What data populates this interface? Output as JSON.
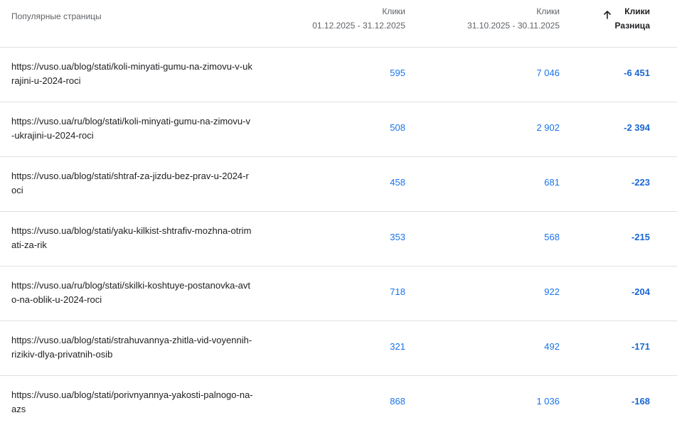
{
  "header": {
    "page_col": "Популярные страницы",
    "col1_metric": "Клики",
    "col1_period": "01.12.2025 - 31.12.2025",
    "col2_metric": "Клики",
    "col2_period": "31.10.2025 - 30.11.2025",
    "col3_metric": "Клики",
    "col3_sub": "Разница",
    "sort_icon": "arrow-up-icon"
  },
  "rows": [
    {
      "url": "https://vuso.ua/blog/stati/koli-minyati-gumu-na-zimovu-v-ukrajini-u-2024-roci",
      "clicks_current": "595",
      "clicks_previous": "7 046",
      "diff": "-6 451"
    },
    {
      "url": "https://vuso.ua/ru/blog/stati/koli-minyati-gumu-na-zimovu-v-ukrajini-u-2024-roci",
      "clicks_current": "508",
      "clicks_previous": "2 902",
      "diff": "-2 394"
    },
    {
      "url": "https://vuso.ua/blog/stati/shtraf-za-jizdu-bez-prav-u-2024-roci",
      "clicks_current": "458",
      "clicks_previous": "681",
      "diff": "-223"
    },
    {
      "url": "https://vuso.ua/blog/stati/yaku-kilkist-shtrafiv-mozhna-otrimati-za-rik",
      "clicks_current": "353",
      "clicks_previous": "568",
      "diff": "-215"
    },
    {
      "url": "https://vuso.ua/ru/blog/stati/skilki-koshtuye-postanovka-avto-na-oblik-u-2024-roci",
      "clicks_current": "718",
      "clicks_previous": "922",
      "diff": "-204"
    },
    {
      "url": "https://vuso.ua/blog/stati/strahuvannya-zhitla-vid-voyennih-rizikiv-dlya-privatnih-osib",
      "clicks_current": "321",
      "clicks_previous": "492",
      "diff": "-171"
    },
    {
      "url": "https://vuso.ua/blog/stati/porivnyannya-yakosti-palnogo-na-azs",
      "clicks_current": "868",
      "clicks_previous": "1 036",
      "diff": "-168"
    }
  ]
}
